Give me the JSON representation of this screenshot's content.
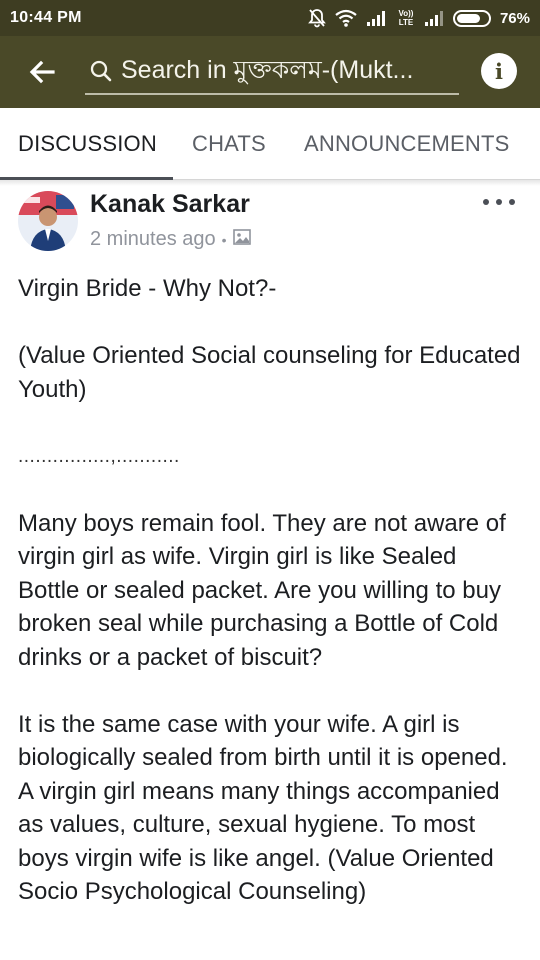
{
  "status_bar": {
    "time": "10:44 PM",
    "network_label": "Vo)) LTE",
    "battery": "76%"
  },
  "app_bar": {
    "search_text": "Search in মুক্তকলম-(Mukt..."
  },
  "tabs": [
    {
      "label": "DISCUSSION",
      "active": true
    },
    {
      "label": "CHATS",
      "active": false
    },
    {
      "label": "ANNOUNCEMENTS",
      "active": false
    }
  ],
  "post": {
    "author": "Kanak Sarkar",
    "time": "2 minutes ago",
    "separator": "•",
    "title": "Virgin Bride - Why Not?-",
    "subtitle": "(Value Oriented Social counseling for Educated Youth)",
    "divider": "................,...........",
    "paragraph1": "Many boys remain fool. They are not aware of virgin girl as wife. Virgin girl is like Sealed Bottle or sealed packet. Are you willing to buy broken seal while purchasing a Bottle of Cold drinks or a packet of biscuit?",
    "paragraph2": "It is the same case with your  wife. A girl is biologically sealed from birth until it is opened. A virgin girl means many things accompanied as values, culture, sexual hygiene. To most boys virgin wife is like angel. (Value Oriented Socio Psychological Counseling)"
  },
  "colors": {
    "status_bar": "#3e3d22",
    "app_bar": "#4a4928",
    "tab_active": "#1c1e21",
    "tab_inactive": "#5b5f66",
    "meta_text": "#90949c"
  }
}
